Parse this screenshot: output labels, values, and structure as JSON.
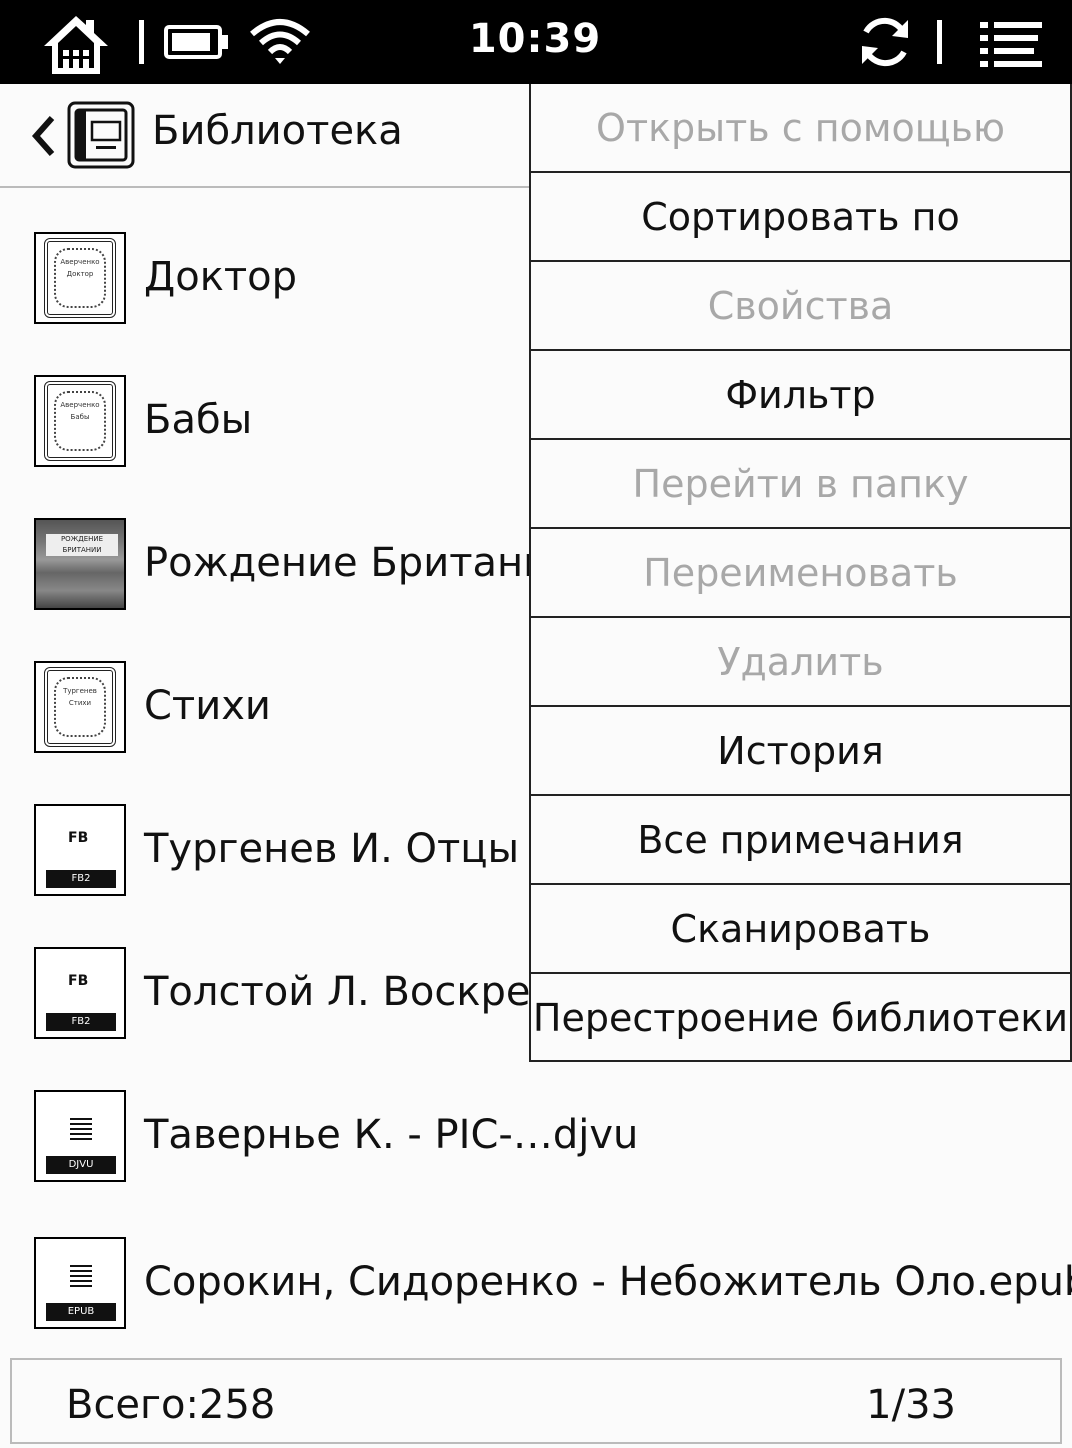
{
  "status_bar": {
    "time": "10:39",
    "icons": [
      "home-icon",
      "battery-icon",
      "wifi-icon",
      "sync-icon",
      "menu-list-icon"
    ]
  },
  "header": {
    "title": "Библиотека",
    "back_icon": "chevron-left-icon",
    "library_icon": "library-icon"
  },
  "books": [
    {
      "title": "Доктор",
      "thumb": "ornate",
      "cover_text": [
        "Аверченко",
        "Доктор"
      ]
    },
    {
      "title": "Бабы",
      "thumb": "ornate",
      "cover_text": [
        "Аверченко",
        "Бабы"
      ]
    },
    {
      "title": "Рождение Британии",
      "thumb": "photo",
      "cover_text": [
        "РОЖДЕНИЕ БРИТАНИИ"
      ]
    },
    {
      "title": "Стихи",
      "thumb": "ornate",
      "cover_text": [
        "Тургенев",
        "Стихи"
      ]
    },
    {
      "title": "Тургенев И. Отцы и д",
      "thumb": "file",
      "format": "FB2"
    },
    {
      "title": "Толстой Л. Воскресе",
      "thumb": "file",
      "format": "FB2"
    },
    {
      "title": "Таверньe К. - PIC-…djvu",
      "thumb": "file",
      "format": "DJVU"
    },
    {
      "title": "Сорокин, Сидоренко - Небожитель Оло.epub",
      "thumb": "file",
      "format": "EPUB"
    }
  ],
  "menu": {
    "items": [
      {
        "label": "Открыть с помощью",
        "enabled": false
      },
      {
        "label": "Сортировать по",
        "enabled": true
      },
      {
        "label": "Свойства",
        "enabled": false
      },
      {
        "label": "Фильтр",
        "enabled": true
      },
      {
        "label": "Перейти в папку",
        "enabled": false
      },
      {
        "label": "Переименовать",
        "enabled": false
      },
      {
        "label": "Удалить",
        "enabled": false
      },
      {
        "label": "История",
        "enabled": true
      },
      {
        "label": "Все примечания",
        "enabled": true
      },
      {
        "label": "Сканировать",
        "enabled": true
      },
      {
        "label": "Перестроение библиотеки",
        "enabled": true
      }
    ]
  },
  "footer": {
    "total": "Всего:258",
    "pages": "1/33"
  }
}
